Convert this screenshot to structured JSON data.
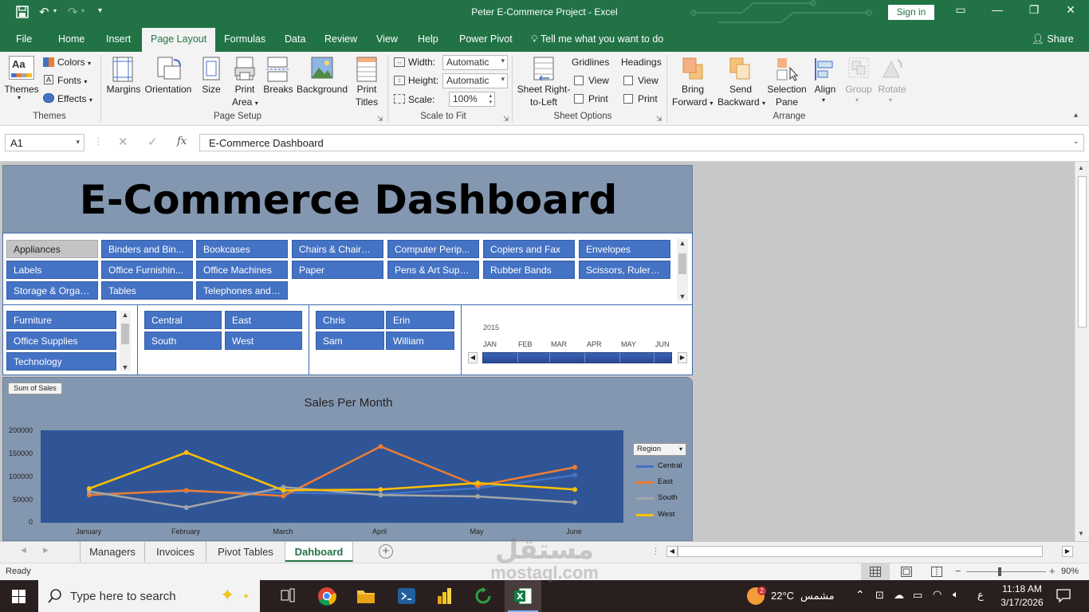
{
  "window": {
    "title": "Peter E-Commerce Project  -  Excel",
    "sign_in": "Sign in"
  },
  "tabs": [
    "File",
    "Home",
    "Insert",
    "Page Layout",
    "Formulas",
    "Data",
    "Review",
    "View",
    "Help",
    "Power Pivot"
  ],
  "active_tab": "Page Layout",
  "tell_me": "Tell me what you want to do",
  "share": "Share",
  "ribbon": {
    "themes": {
      "themes_label": "Themes",
      "colors": "Colors",
      "fonts": "Fonts",
      "effects": "Effects",
      "group": "Themes"
    },
    "page_setup": {
      "margins": "Margins",
      "orientation": "Orientation",
      "size": "Size",
      "print_area_1": "Print",
      "print_area_2": "Area",
      "breaks": "Breaks",
      "background": "Background",
      "print_titles_1": "Print",
      "print_titles_2": "Titles",
      "group": "Page Setup"
    },
    "scale_to_fit": {
      "width_label": "Width:",
      "width_value": "Automatic",
      "height_label": "Height:",
      "height_value": "Automatic",
      "scale_label": "Scale:",
      "scale_value": "100%",
      "group": "Scale to Fit"
    },
    "sheet_options": {
      "sheet_rtl_1": "Sheet Right-",
      "sheet_rtl_2": "to-Left",
      "gridlines": "Gridlines",
      "headings": "Headings",
      "view": "View",
      "print": "Print",
      "group": "Sheet Options"
    },
    "arrange": {
      "bring_1": "Bring",
      "bring_2": "Forward",
      "send_1": "Send",
      "send_2": "Backward",
      "selection_1": "Selection",
      "selection_2": "Pane",
      "align": "Align",
      "group_btn": "Group",
      "rotate": "Rotate",
      "group": "Arrange"
    }
  },
  "formula_bar": {
    "name_box": "A1",
    "fx": "fx",
    "content": "E-Commerce Dashboard"
  },
  "dashboard": {
    "title": "E-Commerce Dashboard",
    "subcategories": [
      "Appliances",
      "Binders and Bin...",
      "Bookcases",
      "Chairs & Chairm...",
      "Computer Perip...",
      "Copiers and Fax",
      "Envelopes",
      "Labels",
      "Office Furnishin...",
      "Office Machines",
      "Paper",
      "Pens & Art Suppl...",
      "Rubber Bands",
      "Scissors, Rulers ...",
      "Storage & Organ...",
      "Tables",
      "Telephones and ..."
    ],
    "categories": [
      "Furniture",
      "Office Supplies",
      "Technology"
    ],
    "regions": [
      "Central",
      "East",
      "South",
      "West"
    ],
    "managers": [
      "Chris",
      "Erin",
      "Sam",
      "William"
    ],
    "timeline": {
      "year": "2015",
      "months": [
        "JAN",
        "FEB",
        "MAR",
        "APR",
        "MAY",
        "JUN"
      ]
    }
  },
  "chart_data": {
    "type": "line",
    "title": "Sales Per Month",
    "field_button": "Sum of Sales",
    "legend_button": "Region",
    "categories": [
      "January",
      "February",
      "March",
      "April",
      "May",
      "June"
    ],
    "series": [
      {
        "name": "Central",
        "color": "#4472c4",
        "values": [
          62000,
          68000,
          65000,
          62000,
          75000,
          103000
        ]
      },
      {
        "name": "East",
        "color": "#ed7d31",
        "values": [
          60000,
          70000,
          58000,
          165000,
          80000,
          120000
        ]
      },
      {
        "name": "South",
        "color": "#a5a5a5",
        "values": [
          68000,
          33000,
          77000,
          60000,
          57000,
          44000
        ]
      },
      {
        "name": "West",
        "color": "#ffc000",
        "values": [
          74000,
          152000,
          70000,
          72000,
          86000,
          72000
        ]
      }
    ],
    "yticks": [
      "200000",
      "150000",
      "100000",
      "50000",
      "0"
    ],
    "ylim": [
      0,
      200000
    ],
    "plot_bg": "#2f5597"
  },
  "sheet_tabs": [
    "Managers",
    "Invoices",
    "Pivot Tables",
    "Dahboard"
  ],
  "active_sheet": "Dahboard",
  "status": {
    "ready": "Ready",
    "zoom": "90%"
  },
  "taskbar": {
    "search": "Type here to search",
    "temp": "22°C",
    "weather": "مشمس",
    "lang": "ع",
    "time": "11:18 AM",
    "date": "3/17/2026",
    "badge": "2"
  },
  "watermark": {
    "line1": "مستقل",
    "line2": "mostaql.com"
  },
  "colors": {
    "excel_green": "#217346",
    "slicer_blue": "#4472c4",
    "dash_bg": "#8497b0"
  }
}
